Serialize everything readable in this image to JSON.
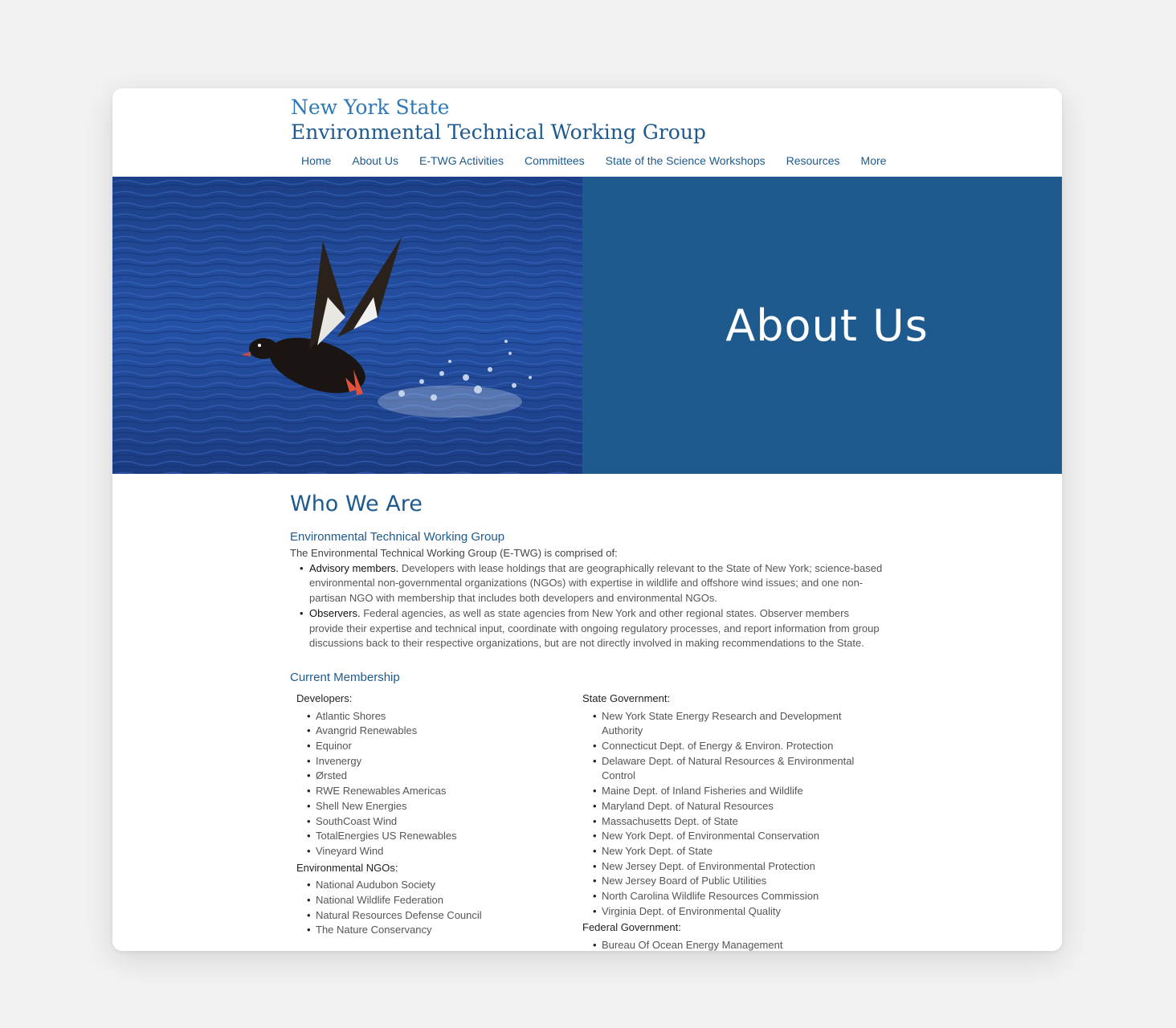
{
  "site": {
    "title_line1": "New York State",
    "title_line2": "Environmental Technical Working Group"
  },
  "nav": {
    "items": [
      "Home",
      "About Us",
      "E-TWG Activities",
      "Committees",
      "State of the Science Workshops",
      "Resources",
      "More"
    ]
  },
  "hero": {
    "title": "About Us",
    "image_icon": "duck-taking-off-water-photo",
    "panel_color": "#1f5a8f"
  },
  "content": {
    "heading": "Who We Are",
    "subheading": "Environmental Technical Working Group",
    "intro": "The Environmental Technical Working Group (E-TWG) is comprised of:",
    "definitions": [
      {
        "term": "Advisory members.",
        "text": " Developers with lease holdings that are geographically relevant to the State of New York; science-based environmental non-governmental organizations (NGOs) with expertise in wildlife and offshore wind issues; and one non-partisan NGO with membership that includes both developers and environmental NGOs."
      },
      {
        "term": "Observers.",
        "text": " Federal agencies, as well as state agencies from New York and other regional states. Observer members provide their expertise and technical input, coordinate with ongoing regulatory processes, and report information from group discussions back to their respective organizations, but are not directly involved in making recommendations to the State."
      }
    ],
    "membership_heading": "Current Membership",
    "developers_title": "Developers:",
    "developers": [
      "Atlantic Shores",
      "Avangrid Renewables",
      "Equinor",
      "Invenergy",
      "Ørsted",
      "RWE Renewables Americas",
      "Shell New Energies",
      "SouthCoast Wind",
      "TotalEnergies US Renewables",
      "Vineyard Wind"
    ],
    "ngos_title": "Environmental NGOs:",
    "ngos": [
      "National Audubon Society",
      "National Wildlife Federation",
      "Natural Resources Defense Council",
      "The Nature Conservancy"
    ],
    "state_title": "State Government:",
    "state": [
      "New York State Energy Research and Development Authority",
      "Connecticut Dept. of Energy & Environ. Protection",
      "Delaware Dept. of Natural Resources & Environmental Control",
      "Maine Dept. of Inland Fisheries and Wildlife",
      "Maryland Dept. of Natural Resources",
      "Massachusetts Dept. of State",
      "New York Dept. of Environmental Conservation",
      "New York Dept. of State",
      "New Jersey Dept. of Environmental Protection",
      "New Jersey Board of Public Utilities",
      "North Carolina Wildlife Resources Commission",
      "Virginia Dept. of Environmental Quality"
    ],
    "federal_title": "Federal Government:",
    "federal": [
      "Bureau Of Ocean Energy Management"
    ]
  }
}
